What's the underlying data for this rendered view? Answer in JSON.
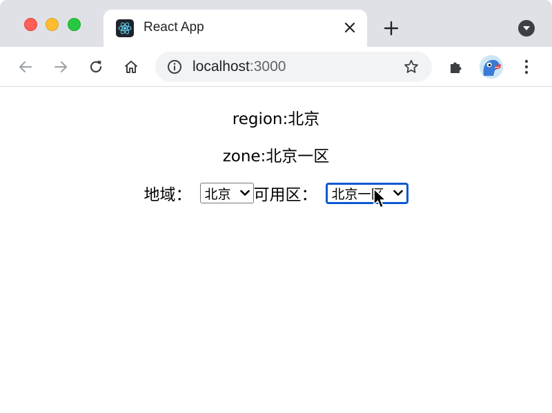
{
  "browser": {
    "tab": {
      "title": "React App",
      "favicon": "react-logo-icon"
    },
    "url": {
      "host": "localhost",
      "port": ":3000"
    },
    "icons": {
      "back": "arrow-left-icon",
      "forward": "arrow-right-icon",
      "reload": "reload-icon",
      "home": "home-icon",
      "info": "info-icon",
      "bookmark": "star-icon",
      "extensions": "puzzle-icon",
      "menu": "kebab-menu-icon",
      "new_tab": "plus-icon",
      "close_tab": "close-icon",
      "tab_search": "chevron-down-icon"
    },
    "colors": {
      "tab_strip": "#dfe1e6",
      "omnibox": "#f1f3f4",
      "focus_ring": "#0b57d0"
    }
  },
  "page": {
    "region_line": "region:北京",
    "zone_line": "zone:北京一区",
    "region_label": "地域：",
    "region_select": {
      "selected": "北京"
    },
    "zone_label": "可用区：",
    "zone_select": {
      "selected": "北京一区"
    }
  }
}
